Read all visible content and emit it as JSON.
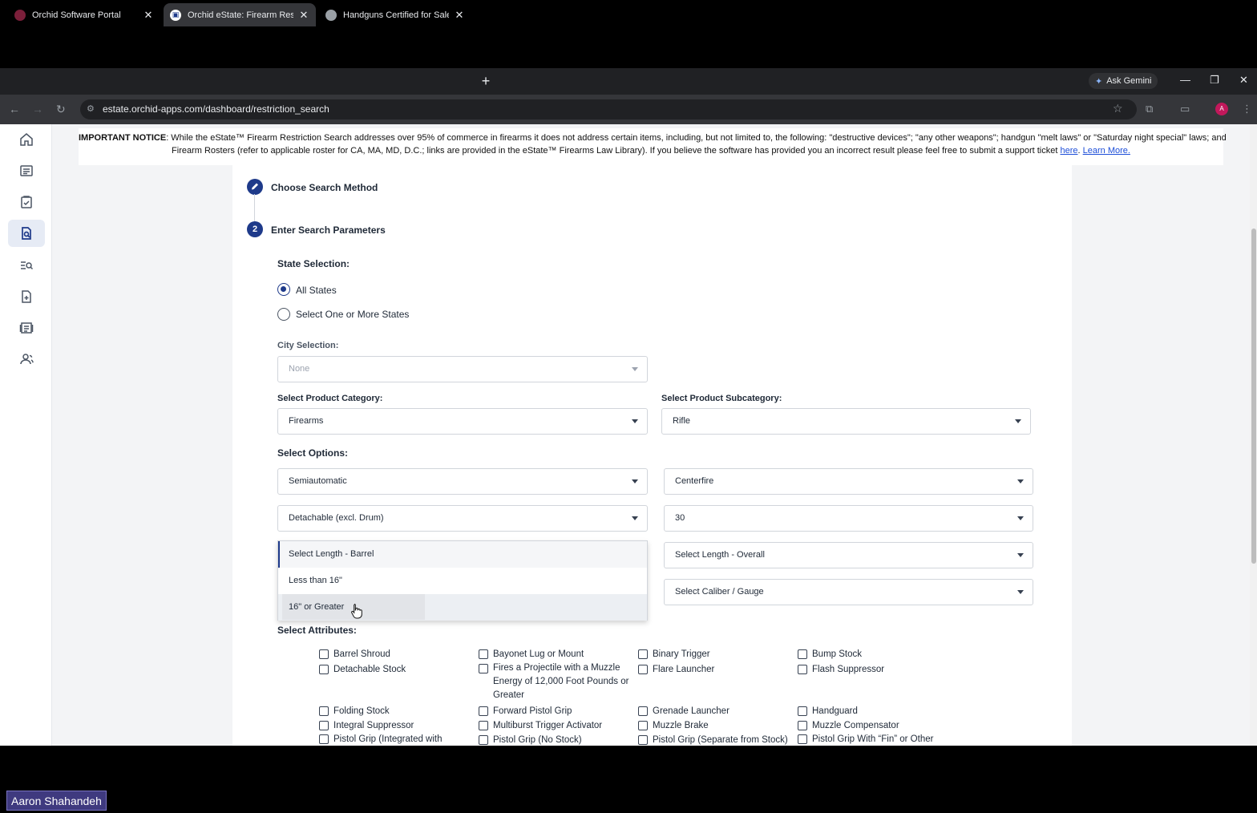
{
  "browser": {
    "tabs": [
      {
        "title": "Orchid Software Portal",
        "active": false
      },
      {
        "title": "Orchid eState: Firearm Restrictio",
        "active": true
      },
      {
        "title": "Handguns Certified for Sale | St",
        "active": false
      }
    ],
    "gemini_label": "Ask Gemini",
    "url": "estate.orchid-apps.com/dashboard/restriction_search",
    "profile_initial": "A"
  },
  "notice": {
    "prefix": "IMPORTANT NOTICE",
    "line1": ": While the eState™ Firearm Restriction Search addresses over 95% of commerce in firearms it does not address certain items, including, but not limited to, the following: \"destructive devices\"; \"any other weapons\"; handgun \"melt laws\" or \"Saturday night special\" laws; and",
    "line2": "Firearm Rosters (refer to applicable roster for CA, MA, MD, D.C.; links are provided in the eState™ Firearms Law Library). If you believe the software has provided you an incorrect result please feel free to submit a support ticket",
    "here": "here",
    "learn_more": "Learn More."
  },
  "steps": [
    {
      "number": "",
      "label": "Choose Search Method"
    },
    {
      "number": "2",
      "label": "Enter Search Parameters"
    }
  ],
  "state_selection": {
    "label": "State Selection:",
    "options": [
      "All States",
      "Select One or More States"
    ],
    "selected": "All States"
  },
  "city_selection": {
    "label": "City Selection:",
    "value": "None"
  },
  "product_category": {
    "label": "Select Product Category:",
    "value": "Firearms"
  },
  "product_subcategory": {
    "label": "Select Product Subcategory:",
    "value": "Rifle"
  },
  "options": {
    "label": "Select Options:",
    "action": "Semiautomatic",
    "ignition": "Centerfire",
    "magazine": "Detachable (excl. Drum)",
    "capacity": "30",
    "length_overall": "Select Length - Overall",
    "caliber": "Select Caliber / Gauge"
  },
  "barrel_dropdown": {
    "placeholder": "Select Length - Barrel",
    "items": [
      "Less than 16\"",
      "16\" or Greater"
    ],
    "hovered": "16\" or Greater"
  },
  "attributes": {
    "label": "Select Attributes:",
    "items": [
      "Barrel Shroud",
      "Bayonet Lug or Mount",
      "Binary Trigger",
      "Bump Stock",
      "Detachable Stock",
      "Fires a Projectile with a Muzzle Energy of 12,000 Foot Pounds or Greater",
      "Flare Launcher",
      "Flash Suppressor",
      "Folding Stock",
      "Forward Pistol Grip",
      "Grenade Launcher",
      "Handguard",
      "Integral Suppressor",
      "Multiburst Trigger Activator",
      "Muzzle Brake",
      "Muzzle Compensator",
      "Pistol Grip (Integrated with",
      "Pistol Grip (No Stock)",
      "Pistol Grip (Separate from Stock)",
      "Pistol Grip With “Fin” or Other"
    ]
  },
  "user_badge": "Aaron Shahandeh"
}
